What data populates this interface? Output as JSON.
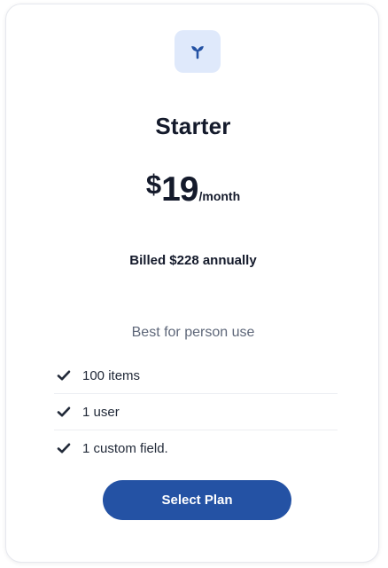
{
  "plan": {
    "icon": "sprout-icon",
    "name": "Starter",
    "price_currency": "$",
    "price_amount": "19",
    "price_period": "/month",
    "billing_note": "Billed $228 annually",
    "tagline": "Best for person use",
    "features": [
      {
        "icon": "check-icon",
        "label": "100 items"
      },
      {
        "icon": "check-icon",
        "label": "1 user"
      },
      {
        "icon": "check-icon",
        "label": "1 custom field."
      }
    ],
    "cta_label": "Select Plan"
  },
  "colors": {
    "accent": "#2452a4",
    "icon_bg": "#dfe9fb",
    "text_primary": "#141a2b",
    "text_muted": "#5e6779"
  }
}
